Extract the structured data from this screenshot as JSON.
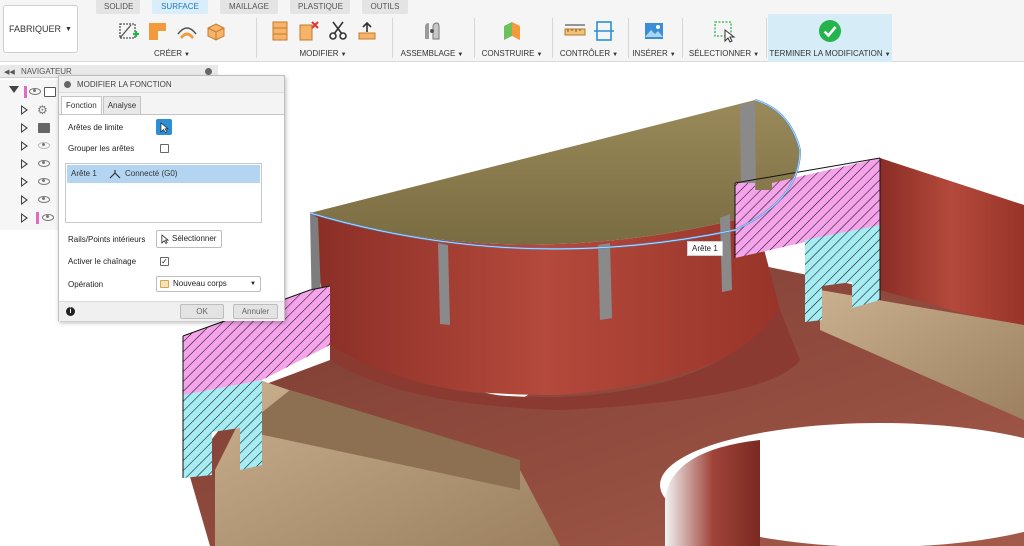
{
  "ribbon": {
    "workspace_button": "FABRIQUER",
    "tabs": [
      "SOLIDE",
      "SURFACE",
      "MAILLAGE",
      "PLASTIQUE",
      "OUTILS"
    ],
    "active_tab": "SURFACE",
    "groups": {
      "creer": "CRÉER",
      "modifier": "MODIFIER",
      "assemblage": "ASSEMBLAGE",
      "construire": "CONSTRUIRE",
      "controler": "CONTRÔLER",
      "inserer": "INSÉRER",
      "selectionner": "SÉLECTIONNER",
      "terminer": "TERMINER LA MODIFICATION"
    },
    "colors": {
      "active_tab": "#1b79c4",
      "finish_check": "#25b34b",
      "creer_accent": "#f39a3c"
    }
  },
  "navigator": {
    "title": "NAVIGATEUR"
  },
  "dialog": {
    "title": "MODIFIER LA FONCTION",
    "tabs": [
      "Fonction",
      "Analyse"
    ],
    "active_tab": "Fonction",
    "fields": {
      "boundary_edges": "Arêtes de limite",
      "group_edges": "Grouper les arêtes",
      "group_edges_checked": false,
      "rails_label": "Rails/Points intérieurs",
      "rails_button": "Sélectionner",
      "chain_label": "Activer le chaînage",
      "chain_checked": true,
      "operation_label": "Opération",
      "operation_value": "Nouveau corps"
    },
    "edges": [
      {
        "name": "Arête 1",
        "continuity": "Connecté (G0)"
      }
    ],
    "ok": "OK",
    "cancel": "Annuler"
  },
  "viewport": {
    "edge_tooltip": "Arête 1",
    "colors": {
      "wall": "#a33a30",
      "top_face": "#8e7e50",
      "hatch_pink": "#f5a3ea",
      "hatch_cyan": "#a5ecf3",
      "wood": "#b89b78",
      "selection": "#4a8fd8"
    }
  }
}
